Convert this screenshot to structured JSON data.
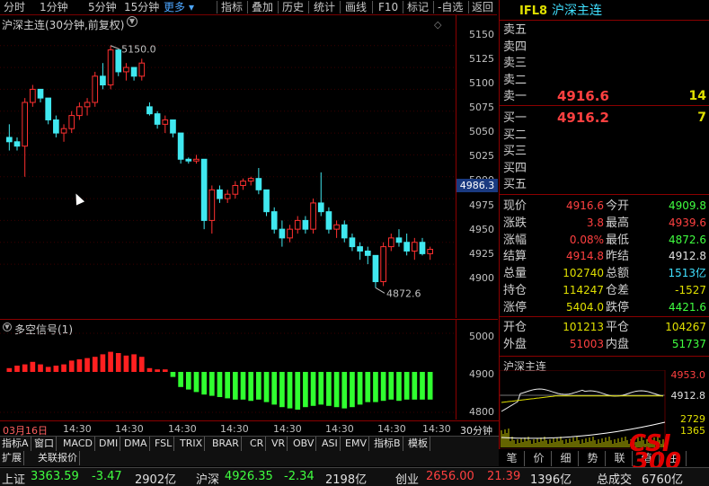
{
  "toolbar": {
    "items": [
      "分时",
      "1分钟",
      "5分钟",
      "15分钟",
      "更多",
      "指标",
      "叠加",
      "历史",
      "统计",
      "画线",
      "F10",
      "标记",
      "-自选",
      "返回"
    ]
  },
  "main_chart": {
    "title": "沪深主连(30分钟,前复权)",
    "high_label": "5150.0",
    "low_label": "4872.6",
    "price_ticks": [
      "5150",
      "5125",
      "5100",
      "5075",
      "5050",
      "5025",
      "5000",
      "4975",
      "4950",
      "4925",
      "4900"
    ],
    "current_marker": "4986.3"
  },
  "indicator": {
    "title": "多空信号(1)",
    "ticks": [
      "5000",
      "4900",
      "4800"
    ]
  },
  "time_axis": {
    "labels": [
      "03月16日",
      "14:30",
      "14:30",
      "14:30",
      "14:30",
      "14:30",
      "14:30",
      "14:30",
      "14:30"
    ],
    "period": "30分钟"
  },
  "orderbook": {
    "contract": "IFL8",
    "name": "沪深主连",
    "asks": [
      {
        "label": "卖五",
        "price": "",
        "vol": ""
      },
      {
        "label": "卖四",
        "price": "",
        "vol": ""
      },
      {
        "label": "卖三",
        "price": "",
        "vol": ""
      },
      {
        "label": "卖二",
        "price": "",
        "vol": ""
      },
      {
        "label": "卖一",
        "price": "4916.6",
        "vol": "14"
      }
    ],
    "bids": [
      {
        "label": "买一",
        "price": "4916.2",
        "vol": "7"
      },
      {
        "label": "买二",
        "price": "",
        "vol": ""
      },
      {
        "label": "买三",
        "price": "",
        "vol": ""
      },
      {
        "label": "买四",
        "price": "",
        "vol": ""
      },
      {
        "label": "买五",
        "price": "",
        "vol": ""
      }
    ]
  },
  "quote": {
    "rows": [
      {
        "l1": "现价",
        "v1": "4916.6",
        "c1": "red",
        "l2": "今开",
        "v2": "4909.8",
        "c2": "green"
      },
      {
        "l1": "涨跌",
        "v1": "3.8",
        "c1": "red",
        "l2": "最高",
        "v2": "4939.6",
        "c2": "red"
      },
      {
        "l1": "涨幅",
        "v1": "0.08%",
        "c1": "red",
        "l2": "最低",
        "v2": "4872.6",
        "c2": "green"
      },
      {
        "l1": "结算",
        "v1": "4914.8",
        "c1": "red",
        "l2": "昨结",
        "v2": "4912.8",
        "c2": "white"
      },
      {
        "l1": "总量",
        "v1": "102740",
        "c1": "yellow",
        "l2": "总额",
        "v2": "1513亿",
        "c2": "cyan"
      },
      {
        "l1": "持仓",
        "v1": "114247",
        "c1": "yellow",
        "l2": "仓差",
        "v2": "-1527",
        "c2": "yellow"
      },
      {
        "l1": "涨停",
        "v1": "5404.0",
        "c1": "yellow",
        "l2": "跌停",
        "v2": "4421.6",
        "c2": "green"
      }
    ],
    "rows2": [
      {
        "l1": "开仓",
        "v1": "101213",
        "c1": "yellow",
        "l2": "平仓",
        "v2": "104267",
        "c2": "yellow"
      },
      {
        "l1": "外盘",
        "v1": "51003",
        "c1": "red",
        "l2": "内盘",
        "v2": "51737",
        "c2": "green"
      }
    ]
  },
  "mini_chart": {
    "title": "沪深主连",
    "ticks": [
      "4953.0",
      "4912.8",
      "2729",
      "1365"
    ]
  },
  "tabs": [
    "指标A",
    "窗口",
    "MACD",
    "DMI",
    "DMA",
    "FSL",
    "TRIX",
    "BRAR",
    "CR",
    "VR",
    "OBV",
    "ASI",
    "EMV",
    "指标B",
    "模板"
  ],
  "tabs2": [
    "扩展",
    "关联报价"
  ],
  "right_tabs": [
    "笔",
    "价",
    "细",
    "势",
    "联",
    "值",
    "主"
  ],
  "status": {
    "sh_label": "上证",
    "sh_val": "3363.59",
    "sh_chg": "-3.47",
    "sh_amt": "2902亿",
    "hs_label": "沪深",
    "hs_val": "4926.35",
    "hs_chg": "-2.34",
    "hs_amt": "2198亿",
    "cy_label": "创业",
    "cy_val": "2656.00",
    "cy_chg": "21.39",
    "cy_amt": "1396亿",
    "total_label": "总成交",
    "total_val": "6760亿"
  },
  "logo": {
    "line1": "CSI",
    "line2": "300"
  },
  "colors": {
    "up": "#ff3030",
    "down": "#40e8f0",
    "ind_up": "#ff2020",
    "ind_down": "#30ff30",
    "border": "#8b0000"
  },
  "chart_data": {
    "type": "candlestick",
    "ylim": [
      4860,
      5160
    ],
    "candles": [
      [
        5045,
        5060,
        5030,
        5040
      ],
      [
        5040,
        5045,
        5030,
        5035
      ],
      [
        5035,
        5090,
        5000,
        5085
      ],
      [
        5085,
        5105,
        5080,
        5100
      ],
      [
        5100,
        5095,
        5085,
        5090
      ],
      [
        5090,
        5080,
        5060,
        5065
      ],
      [
        5065,
        5070,
        5045,
        5050
      ],
      [
        5050,
        5060,
        5040,
        5055
      ],
      [
        5055,
        5075,
        5050,
        5070
      ],
      [
        5070,
        5085,
        5065,
        5080
      ],
      [
        5080,
        5090,
        5070,
        5085
      ],
      [
        5085,
        5120,
        5080,
        5115
      ],
      [
        5115,
        5130,
        5100,
        5105
      ],
      [
        5105,
        5150,
        5100,
        5145
      ],
      [
        5145,
        5140,
        5115,
        5120
      ],
      [
        5120,
        5130,
        5110,
        5125
      ],
      [
        5125,
        5120,
        5110,
        5115
      ],
      [
        5115,
        5135,
        5110,
        5130
      ],
      [
        5080,
        5085,
        5070,
        5072
      ],
      [
        5072,
        5075,
        5055,
        5060
      ],
      [
        5060,
        5070,
        5050,
        5065
      ],
      [
        5065,
        5060,
        5045,
        5050
      ],
      [
        5050,
        5045,
        5015,
        5020
      ],
      [
        5020,
        5022,
        5015,
        5018
      ],
      [
        5018,
        5025,
        5015,
        5020
      ],
      [
        5020,
        5010,
        4940,
        4950
      ],
      [
        4950,
        4990,
        4935,
        4985
      ],
      [
        4985,
        4990,
        4970,
        4975
      ],
      [
        4975,
        4985,
        4970,
        4980
      ],
      [
        4980,
        4995,
        4975,
        4990
      ],
      [
        4990,
        4998,
        4985,
        4995
      ],
      [
        4995,
        5000,
        4990,
        4998
      ],
      [
        4998,
        5010,
        4980,
        4985
      ],
      [
        4985,
        4980,
        4955,
        4960
      ],
      [
        4960,
        4965,
        4935,
        4940
      ],
      [
        4940,
        4950,
        4920,
        4930
      ],
      [
        4930,
        4945,
        4925,
        4940
      ],
      [
        4940,
        4955,
        4935,
        4950
      ],
      [
        4950,
        4955,
        4935,
        4940
      ],
      [
        4940,
        4975,
        4935,
        4970
      ],
      [
        4970,
        5005,
        4955,
        4960
      ],
      [
        4960,
        4965,
        4935,
        4940
      ],
      [
        4940,
        4950,
        4930,
        4945
      ],
      [
        4945,
        4950,
        4925,
        4930
      ],
      [
        4930,
        4935,
        4915,
        4920
      ],
      [
        4920,
        4925,
        4905,
        4915
      ],
      [
        4915,
        4920,
        4900,
        4910
      ],
      [
        4910,
        4905,
        4873,
        4880
      ],
      [
        4880,
        4925,
        4875,
        4920
      ],
      [
        4920,
        4935,
        4915,
        4930
      ],
      [
        4930,
        4940,
        4920,
        4925
      ],
      [
        4925,
        4935,
        4910,
        4915
      ],
      [
        4915,
        4930,
        4905,
        4925
      ],
      [
        4925,
        4930,
        4910,
        4912
      ],
      [
        4912,
        4920,
        4905,
        4917
      ]
    ],
    "signal": [
      0.3,
      0.5,
      0.6,
      0.8,
      0.6,
      0.4,
      0.5,
      0.6,
      0.9,
      1.0,
      1.1,
      1.2,
      1.4,
      1.6,
      1.5,
      1.3,
      1.4,
      1.2,
      0.3,
      0.2,
      0.2,
      -0.4,
      -1.2,
      -1.4,
      -1.6,
      -1.8,
      -1.9,
      -2.0,
      -2.1,
      -2.2,
      -2.2,
      -2.3,
      -2.2,
      -2.4,
      -2.6,
      -2.8,
      -2.9,
      -3.0,
      -2.8,
      -2.7,
      -2.6,
      -2.7,
      -2.8,
      -2.9,
      -2.8,
      -2.6,
      -2.4,
      -2.4,
      -2.3,
      -2.2,
      -2.3,
      -2.2,
      -2.2,
      -2.2,
      -2.2
    ]
  }
}
